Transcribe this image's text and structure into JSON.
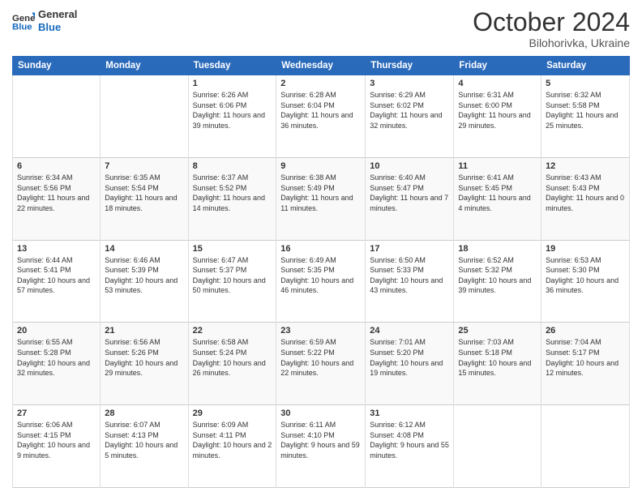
{
  "header": {
    "logo_line1": "General",
    "logo_line2": "Blue",
    "month": "October 2024",
    "location": "Bilohorivka, Ukraine"
  },
  "days_of_week": [
    "Sunday",
    "Monday",
    "Tuesday",
    "Wednesday",
    "Thursday",
    "Friday",
    "Saturday"
  ],
  "weeks": [
    [
      {
        "day": "",
        "content": ""
      },
      {
        "day": "",
        "content": ""
      },
      {
        "day": "1",
        "content": "Sunrise: 6:26 AM\nSunset: 6:06 PM\nDaylight: 11 hours and 39 minutes."
      },
      {
        "day": "2",
        "content": "Sunrise: 6:28 AM\nSunset: 6:04 PM\nDaylight: 11 hours and 36 minutes."
      },
      {
        "day": "3",
        "content": "Sunrise: 6:29 AM\nSunset: 6:02 PM\nDaylight: 11 hours and 32 minutes."
      },
      {
        "day": "4",
        "content": "Sunrise: 6:31 AM\nSunset: 6:00 PM\nDaylight: 11 hours and 29 minutes."
      },
      {
        "day": "5",
        "content": "Sunrise: 6:32 AM\nSunset: 5:58 PM\nDaylight: 11 hours and 25 minutes."
      }
    ],
    [
      {
        "day": "6",
        "content": "Sunrise: 6:34 AM\nSunset: 5:56 PM\nDaylight: 11 hours and 22 minutes."
      },
      {
        "day": "7",
        "content": "Sunrise: 6:35 AM\nSunset: 5:54 PM\nDaylight: 11 hours and 18 minutes."
      },
      {
        "day": "8",
        "content": "Sunrise: 6:37 AM\nSunset: 5:52 PM\nDaylight: 11 hours and 14 minutes."
      },
      {
        "day": "9",
        "content": "Sunrise: 6:38 AM\nSunset: 5:49 PM\nDaylight: 11 hours and 11 minutes."
      },
      {
        "day": "10",
        "content": "Sunrise: 6:40 AM\nSunset: 5:47 PM\nDaylight: 11 hours and 7 minutes."
      },
      {
        "day": "11",
        "content": "Sunrise: 6:41 AM\nSunset: 5:45 PM\nDaylight: 11 hours and 4 minutes."
      },
      {
        "day": "12",
        "content": "Sunrise: 6:43 AM\nSunset: 5:43 PM\nDaylight: 11 hours and 0 minutes."
      }
    ],
    [
      {
        "day": "13",
        "content": "Sunrise: 6:44 AM\nSunset: 5:41 PM\nDaylight: 10 hours and 57 minutes."
      },
      {
        "day": "14",
        "content": "Sunrise: 6:46 AM\nSunset: 5:39 PM\nDaylight: 10 hours and 53 minutes."
      },
      {
        "day": "15",
        "content": "Sunrise: 6:47 AM\nSunset: 5:37 PM\nDaylight: 10 hours and 50 minutes."
      },
      {
        "day": "16",
        "content": "Sunrise: 6:49 AM\nSunset: 5:35 PM\nDaylight: 10 hours and 46 minutes."
      },
      {
        "day": "17",
        "content": "Sunrise: 6:50 AM\nSunset: 5:33 PM\nDaylight: 10 hours and 43 minutes."
      },
      {
        "day": "18",
        "content": "Sunrise: 6:52 AM\nSunset: 5:32 PM\nDaylight: 10 hours and 39 minutes."
      },
      {
        "day": "19",
        "content": "Sunrise: 6:53 AM\nSunset: 5:30 PM\nDaylight: 10 hours and 36 minutes."
      }
    ],
    [
      {
        "day": "20",
        "content": "Sunrise: 6:55 AM\nSunset: 5:28 PM\nDaylight: 10 hours and 32 minutes."
      },
      {
        "day": "21",
        "content": "Sunrise: 6:56 AM\nSunset: 5:26 PM\nDaylight: 10 hours and 29 minutes."
      },
      {
        "day": "22",
        "content": "Sunrise: 6:58 AM\nSunset: 5:24 PM\nDaylight: 10 hours and 26 minutes."
      },
      {
        "day": "23",
        "content": "Sunrise: 6:59 AM\nSunset: 5:22 PM\nDaylight: 10 hours and 22 minutes."
      },
      {
        "day": "24",
        "content": "Sunrise: 7:01 AM\nSunset: 5:20 PM\nDaylight: 10 hours and 19 minutes."
      },
      {
        "day": "25",
        "content": "Sunrise: 7:03 AM\nSunset: 5:18 PM\nDaylight: 10 hours and 15 minutes."
      },
      {
        "day": "26",
        "content": "Sunrise: 7:04 AM\nSunset: 5:17 PM\nDaylight: 10 hours and 12 minutes."
      }
    ],
    [
      {
        "day": "27",
        "content": "Sunrise: 6:06 AM\nSunset: 4:15 PM\nDaylight: 10 hours and 9 minutes."
      },
      {
        "day": "28",
        "content": "Sunrise: 6:07 AM\nSunset: 4:13 PM\nDaylight: 10 hours and 5 minutes."
      },
      {
        "day": "29",
        "content": "Sunrise: 6:09 AM\nSunset: 4:11 PM\nDaylight: 10 hours and 2 minutes."
      },
      {
        "day": "30",
        "content": "Sunrise: 6:11 AM\nSunset: 4:10 PM\nDaylight: 9 hours and 59 minutes."
      },
      {
        "day": "31",
        "content": "Sunrise: 6:12 AM\nSunset: 4:08 PM\nDaylight: 9 hours and 55 minutes."
      },
      {
        "day": "",
        "content": ""
      },
      {
        "day": "",
        "content": ""
      }
    ]
  ]
}
